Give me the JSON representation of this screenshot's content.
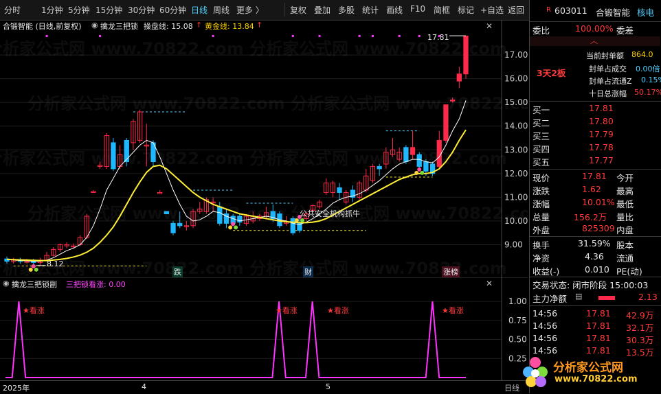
{
  "toolbar": {
    "tabs": [
      "分时",
      "1分钟",
      "5分钟",
      "15分钟",
      "30分钟",
      "60分钟",
      "日线",
      "周线"
    ],
    "more": "更多 〉",
    "actions": [
      "复权",
      "叠加",
      "多股",
      "统计",
      "画线",
      "F10",
      "简框",
      "标记",
      "+自选",
      "返回"
    ]
  },
  "chart_header": {
    "name": "合锻智能 (日线,前复权)",
    "indicator_name": "擒龙三把锁",
    "line1_label": "操盘线: 15.08",
    "line1_arrow": "↑",
    "line2_label": "黄金线: 13.84",
    "line2_arrow": "↑"
  },
  "price_labels": {
    "high": "17.81",
    "low": "8.12",
    "annotation": "公共安全机构抓牛"
  },
  "event_labels": [
    "跌",
    "财",
    "涨榜"
  ],
  "lower_header": {
    "name": "擒龙三把锁副",
    "value": "三把锁看涨: 0.00"
  },
  "signal_label": "★看涨",
  "x_labels": [
    "2025年",
    "4",
    "5"
  ],
  "x_axis_unit": "日线",
  "chart_data": [
    {
      "type": "candlestick",
      "title": "合锻智能 (日线,前复权)",
      "y_ticks": [
        9.0,
        10.0,
        11.0,
        12.0,
        13.0,
        14.0,
        15.0,
        16.0,
        17.0
      ],
      "ylim": [
        8.0,
        17.9
      ],
      "candles": [
        {
          "o": 8.4,
          "c": 8.3,
          "h": 8.5,
          "l": 8.2
        },
        {
          "o": 8.3,
          "c": 8.35,
          "h": 8.45,
          "l": 8.2
        },
        {
          "o": 8.35,
          "c": 8.3,
          "h": 8.45,
          "l": 8.2
        },
        {
          "o": 8.3,
          "c": 8.3,
          "h": 8.4,
          "l": 8.2
        },
        {
          "o": 8.3,
          "c": 8.25,
          "h": 8.4,
          "l": 8.12
        },
        {
          "o": 8.25,
          "c": 8.35,
          "h": 8.45,
          "l": 8.15
        },
        {
          "o": 8.35,
          "c": 8.55,
          "h": 8.7,
          "l": 8.3
        },
        {
          "o": 8.55,
          "c": 8.8,
          "h": 8.9,
          "l": 8.5
        },
        {
          "o": 8.8,
          "c": 9.0,
          "h": 9.05,
          "l": 8.7
        },
        {
          "o": 8.95,
          "c": 9.0,
          "h": 9.1,
          "l": 8.85
        },
        {
          "o": 8.95,
          "c": 8.95,
          "h": 9.05,
          "l": 8.85
        },
        {
          "o": 9.0,
          "c": 9.3,
          "h": 9.4,
          "l": 8.95
        },
        {
          "o": 9.3,
          "c": 10.2,
          "h": 10.3,
          "l": 9.25
        },
        {
          "o": 11.2,
          "c": 11.25,
          "h": 11.3,
          "l": 11.2
        },
        {
          "o": 12.3,
          "c": 12.35,
          "h": 12.5,
          "l": 12.2
        },
        {
          "o": 12.3,
          "c": 13.6,
          "h": 13.7,
          "l": 12.2
        },
        {
          "o": 13.3,
          "c": 12.2,
          "h": 13.5,
          "l": 12.1
        },
        {
          "o": 12.3,
          "c": 12.8,
          "h": 13.2,
          "l": 12.2
        },
        {
          "o": 13.4,
          "c": 12.5,
          "h": 13.5,
          "l": 12.3
        },
        {
          "o": 13.3,
          "c": 14.2,
          "h": 14.3,
          "l": 13.0
        },
        {
          "o": 13.4,
          "c": 14.6,
          "h": 14.7,
          "l": 13.3
        },
        {
          "o": 13.2,
          "c": 13.2,
          "h": 14.1,
          "l": 12.3
        },
        {
          "o": 13.3,
          "c": 12.5,
          "h": 13.4,
          "l": 12.3
        },
        {
          "o": 11.2,
          "c": 11.2,
          "h": 11.3,
          "l": 11.2
        },
        {
          "o": 10.4,
          "c": 10.3,
          "h": 10.4,
          "l": 10.3
        },
        {
          "o": 9.9,
          "c": 9.5,
          "h": 10.0,
          "l": 9.4
        },
        {
          "o": 9.9,
          "c": 9.8,
          "h": 10.4,
          "l": 9.7
        },
        {
          "o": 9.8,
          "c": 9.8,
          "h": 10.0,
          "l": 9.6
        },
        {
          "o": 9.8,
          "c": 10.4,
          "h": 10.5,
          "l": 9.7
        },
        {
          "o": 10.4,
          "c": 10.5,
          "h": 10.8,
          "l": 10.3
        },
        {
          "o": 10.4,
          "c": 10.9,
          "h": 11.0,
          "l": 10.3
        },
        {
          "o": 10.8,
          "c": 10.8,
          "h": 11.0,
          "l": 10.4
        },
        {
          "o": 10.6,
          "c": 9.9,
          "h": 10.8,
          "l": 9.8
        },
        {
          "o": 10.3,
          "c": 9.9,
          "h": 10.5,
          "l": 9.7
        },
        {
          "o": 10.2,
          "c": 9.9,
          "h": 10.3,
          "l": 9.8
        },
        {
          "o": 10.2,
          "c": 9.95,
          "h": 10.3,
          "l": 9.8
        },
        {
          "o": 9.9,
          "c": 10.2,
          "h": 10.3,
          "l": 9.8
        },
        {
          "o": 10.0,
          "c": 10.2,
          "h": 10.4,
          "l": 9.9
        },
        {
          "o": 10.1,
          "c": 10.2,
          "h": 10.3,
          "l": 10.0
        },
        {
          "o": 10.2,
          "c": 10.35,
          "h": 10.6,
          "l": 10.1
        },
        {
          "o": 10.4,
          "c": 10.1,
          "h": 10.7,
          "l": 9.95
        },
        {
          "o": 10.3,
          "c": 9.8,
          "h": 10.4,
          "l": 9.7
        },
        {
          "o": 9.9,
          "c": 9.95,
          "h": 10.2,
          "l": 9.8
        },
        {
          "o": 10.1,
          "c": 9.5,
          "h": 10.2,
          "l": 9.4
        },
        {
          "o": 9.9,
          "c": 9.6,
          "h": 10.1,
          "l": 9.5
        },
        {
          "o": 10.1,
          "c": 10.3,
          "h": 10.4,
          "l": 10.0
        },
        {
          "o": 10.45,
          "c": 10.65,
          "h": 10.7,
          "l": 10.4
        },
        {
          "o": 10.6,
          "c": 10.8,
          "h": 10.9,
          "l": 10.5
        },
        {
          "o": 11.2,
          "c": 11.6,
          "h": 11.8,
          "l": 11.1
        },
        {
          "o": 11.2,
          "c": 11.6,
          "h": 11.7,
          "l": 11.0
        },
        {
          "o": 11.4,
          "c": 11.2,
          "h": 11.6,
          "l": 10.9
        },
        {
          "o": 10.8,
          "c": 11.2,
          "h": 11.3,
          "l": 10.7
        },
        {
          "o": 11.3,
          "c": 11.0,
          "h": 11.5,
          "l": 10.8
        },
        {
          "o": 11.0,
          "c": 11.6,
          "h": 11.7,
          "l": 10.9
        },
        {
          "o": 11.3,
          "c": 11.9,
          "h": 12.2,
          "l": 11.2
        },
        {
          "o": 11.7,
          "c": 12.3,
          "h": 12.4,
          "l": 11.6
        },
        {
          "o": 12.3,
          "c": 12.2,
          "h": 12.4,
          "l": 11.9
        },
        {
          "o": 12.4,
          "c": 12.9,
          "h": 13.1,
          "l": 12.2
        },
        {
          "o": 12.8,
          "c": 13.0,
          "h": 13.5,
          "l": 12.7
        },
        {
          "o": 12.6,
          "c": 12.9,
          "h": 13.1,
          "l": 12.5
        },
        {
          "o": 13.1,
          "c": 12.5,
          "h": 13.2,
          "l": 12.4
        },
        {
          "o": 12.8,
          "c": 13.1,
          "h": 13.8,
          "l": 12.6
        },
        {
          "o": 12.8,
          "c": 12.3,
          "h": 12.9,
          "l": 12.2
        },
        {
          "o": 12.5,
          "c": 12.1,
          "h": 12.6,
          "l": 11.9
        },
        {
          "o": 12.4,
          "c": 12.0,
          "h": 12.5,
          "l": 11.9
        },
        {
          "o": 12.3,
          "c": 13.4,
          "h": 13.8,
          "l": 12.2
        },
        {
          "o": 13.4,
          "c": 14.9,
          "h": 14.9,
          "l": 13.3
        },
        {
          "o": 15.1,
          "c": 15.1,
          "h": 15.2,
          "l": 15.0
        },
        {
          "o": 15.9,
          "c": 16.2,
          "h": 16.5,
          "l": 15.6
        },
        {
          "o": 16.2,
          "c": 17.8,
          "h": 17.81,
          "l": 16.0
        }
      ],
      "series": [
        {
          "name": "操盘线",
          "color": "#ffffff",
          "values": [
            8.4,
            8.35,
            8.33,
            8.32,
            8.3,
            8.3,
            8.35,
            8.45,
            8.6,
            8.75,
            8.85,
            9.0,
            9.3,
            9.8,
            10.5,
            11.3,
            11.8,
            12.3,
            12.6,
            12.9,
            13.2,
            13.4,
            13.3,
            12.7,
            12.0,
            11.3,
            10.7,
            10.2,
            10.0,
            10.05,
            10.2,
            10.4,
            10.35,
            10.2,
            10.1,
            10.0,
            10.05,
            10.1,
            10.15,
            10.2,
            10.15,
            10.05,
            10.0,
            9.9,
            9.85,
            9.95,
            10.1,
            10.3,
            10.5,
            10.75,
            10.9,
            11.0,
            11.05,
            11.15,
            11.3,
            11.5,
            11.7,
            11.95,
            12.2,
            12.4,
            12.5,
            12.6,
            12.6,
            12.5,
            12.45,
            12.7,
            13.2,
            13.8,
            14.3,
            15.08
          ]
        },
        {
          "name": "黄金线",
          "color": "#ffee33",
          "values": [
            8.38,
            8.37,
            8.36,
            8.35,
            8.34,
            8.33,
            8.33,
            8.35,
            8.38,
            8.42,
            8.48,
            8.56,
            8.68,
            8.85,
            9.1,
            9.4,
            9.75,
            10.2,
            10.7,
            11.2,
            11.65,
            12.05,
            12.3,
            12.35,
            12.2,
            11.95,
            11.7,
            11.45,
            11.2,
            11.0,
            10.85,
            10.7,
            10.6,
            10.5,
            10.4,
            10.3,
            10.25,
            10.2,
            10.15,
            10.1,
            10.05,
            10.0,
            9.97,
            9.95,
            9.93,
            9.93,
            9.95,
            10.0,
            10.1,
            10.25,
            10.4,
            10.55,
            10.7,
            10.85,
            11.0,
            11.15,
            11.3,
            11.45,
            11.6,
            11.75,
            11.85,
            11.95,
            12.0,
            12.0,
            12.05,
            12.2,
            12.5,
            12.9,
            13.4,
            13.84
          ]
        }
      ]
    },
    {
      "type": "line",
      "title": "擒龙三把锁副",
      "y_ticks": [
        0.25,
        0.5,
        0.75,
        1.0
      ],
      "ylim": [
        0,
        1.1
      ],
      "series": [
        {
          "name": "三把锁看涨",
          "color": "#ff33ff",
          "values": [
            0,
            0,
            1,
            0,
            0,
            0,
            0,
            0,
            0,
            0,
            0,
            0,
            0,
            0,
            0,
            0,
            0,
            0,
            0,
            0,
            0,
            0,
            0,
            0,
            0,
            0,
            0,
            0,
            0,
            0,
            0,
            0,
            0,
            0,
            0,
            0,
            0,
            0,
            0,
            0,
            0,
            1,
            0,
            0,
            0,
            0,
            1,
            0,
            0,
            0,
            0,
            0,
            0,
            0,
            0,
            0,
            0,
            0,
            0,
            0,
            0,
            0,
            0,
            0,
            1,
            0,
            0,
            0,
            0,
            0
          ]
        }
      ]
    }
  ],
  "right_panel": {
    "code": "603011",
    "name": "合锻智能",
    "tag": "核电",
    "weibi_label": "委比",
    "weibi_value": "100.00%",
    "weicha_label": "委差",
    "seal_label": "3天2板",
    "seal_items": [
      {
        "label": "当前封单额",
        "value": "864.0"
      },
      {
        "label": "封单占成交",
        "value": "0.00倍"
      },
      {
        "label": "封单占流通Z",
        "value": "0.15%"
      },
      {
        "label": "十日总涨幅",
        "value": "50.17%"
      }
    ],
    "bids": [
      {
        "label": "买一",
        "price": "17.81",
        "vol": ""
      },
      {
        "label": "买二",
        "price": "17.80",
        "vol": ""
      },
      {
        "label": "买三",
        "price": "17.79",
        "vol": ""
      },
      {
        "label": "买四",
        "price": "17.78",
        "vol": ""
      },
      {
        "label": "买五",
        "price": "17.77",
        "vol": ""
      }
    ],
    "quote": [
      {
        "l1": "现价",
        "v1": "17.81",
        "l2": "今开",
        "v2": ""
      },
      {
        "l1": "涨跌",
        "v1": "1.62",
        "l2": "最高",
        "v2": ""
      },
      {
        "l1": "涨幅",
        "v1": "10.01%",
        "l2": "最低",
        "v2": ""
      },
      {
        "l1": "总量",
        "v1": "156.2万",
        "l2": "量比",
        "v2": ""
      },
      {
        "l1": "外盘",
        "v1": "825309",
        "l2": "内盘",
        "v2": ""
      }
    ],
    "quote2": [
      {
        "l1": "换手",
        "v1": "31.59%",
        "l2": "股本"
      },
      {
        "l1": "净资",
        "v1": "4.36",
        "l2": "流通"
      },
      {
        "l1": "收益(-)",
        "v1": "0.010",
        "l2": "PE(动)"
      }
    ],
    "trade_status": "交易状态: 闭市阶段 15:00:03",
    "main_flow_label": "主力净额",
    "main_flow_value": "2.13",
    "ticks": [
      {
        "time": "14:56",
        "price": "17.81",
        "vol": "42.9万"
      },
      {
        "time": "14:56",
        "price": "17.81",
        "vol": "32.1万"
      },
      {
        "time": "14:56",
        "price": "17.81",
        "vol": "30.3万"
      },
      {
        "time": "14:56",
        "price": "17.81",
        "vol": "13.5万"
      }
    ],
    "logo_text": "分析家公式网",
    "logo_url": "www.70822.com"
  }
}
